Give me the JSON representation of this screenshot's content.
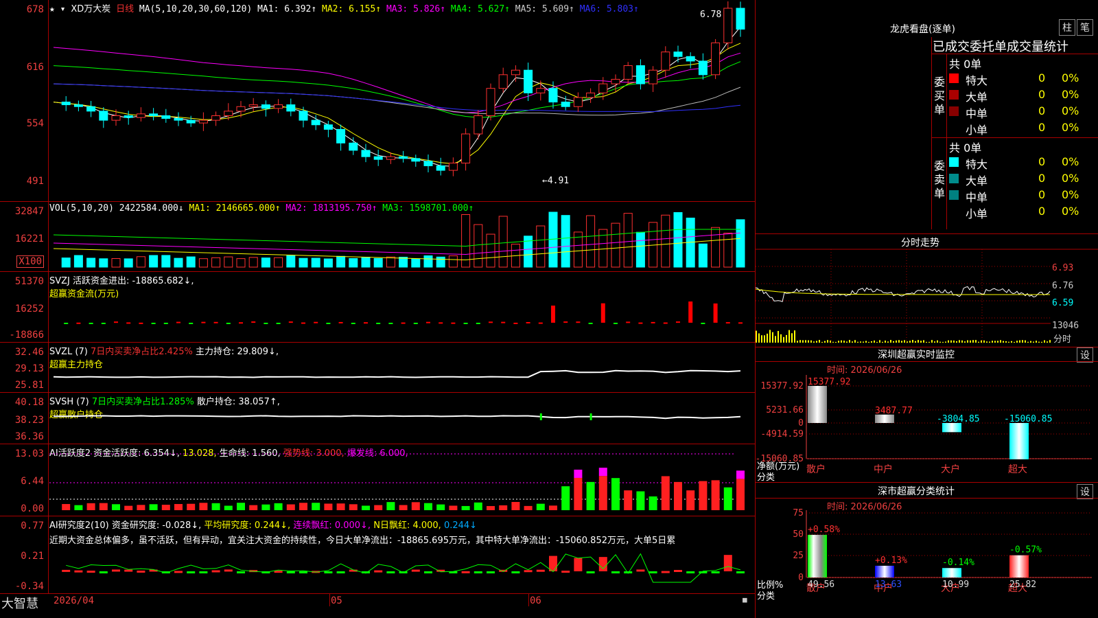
{
  "kline": {
    "stock": "XD万大炭",
    "period": "日线",
    "ma_label": "MA(5,10,20,30,60,120)",
    "ma_values": [
      {
        "text": "MA1: 6.392↑",
        "color": "#ffffff"
      },
      {
        "text": "MA2: 6.155↑",
        "color": "#ffff00"
      },
      {
        "text": "MA3: 5.826↑",
        "color": "#ff00ff"
      },
      {
        "text": "MA4: 5.627↑",
        "color": "#00ff00"
      },
      {
        "text": "MA5: 5.609↑",
        "color": "#cccccc"
      },
      {
        "text": "MA6: 5.803↑",
        "color": "#3030ff"
      }
    ],
    "ticks": [
      "678",
      "616",
      "554",
      "491"
    ],
    "high_label": "6.78",
    "low_label": "←4.91"
  },
  "vol": {
    "title": "VOL(5,10,20)",
    "value": "2422584.000↓",
    "mas": [
      {
        "text": "MA1: 2146665.000↑",
        "color": "#ffff00"
      },
      {
        "text": "MA2: 1813195.750↑",
        "color": "#ff00ff"
      },
      {
        "text": "MA3: 1598701.000↑",
        "color": "#00ff00"
      }
    ],
    "ticks": [
      "32847",
      "16221"
    ],
    "unit": "X100"
  },
  "svzj": {
    "title": "SVZJ  活跃资金进出: -18865.682↓,",
    "subtitle": "超赢资金流(万元)",
    "ticks": [
      "51370",
      "16252",
      "-18866"
    ]
  },
  "svzl": {
    "title_a": "SVZL (7)",
    "title_b": "7日内买卖净占比2.425%",
    "title_c": "主力持仓: 29.809↓,",
    "subtitle": "超赢主力持仓",
    "ticks": [
      "32.46",
      "29.13",
      "25.81"
    ]
  },
  "svsh": {
    "title_a": "SVSH (7)",
    "title_b": "7日内买卖净占比1.285%",
    "title_c": "散户持仓: 38.057↑,",
    "subtitle": "超赢散户持仓",
    "ticks": [
      "40.18",
      "38.23",
      "36.36"
    ]
  },
  "ai1": {
    "title": "AI活跃度2 资金活跃度: 6.354↓,",
    "v2": "13.028,",
    "v3": "生命线: 1.560,",
    "v4": "强势线: 3.000,",
    "v5": "爆发线: 6.000,",
    "ticks": [
      "13.03",
      "6.44",
      "0.00"
    ]
  },
  "ai2": {
    "title": "AI研究度2(10) 资金研究度: -0.028↓,",
    "v2": "平均研究度: 0.244↓,",
    "v3": "连续飘红: 0.000↓,",
    "v4": "N日飘红: 4.000,",
    "v5": "0.244↓",
    "commentary": "近期大资金总体偏多，虽不活跃，但有异动，宜关注大资金的持续性，今日大单净流出：-18865.695万元，其中特大单净流出：-15060.852万元，大单5日累",
    "ticks": [
      "0.77",
      "0.21",
      "-0.34"
    ]
  },
  "bottom": {
    "app": "大智慧",
    "dates": [
      "2026/04",
      "05",
      "06"
    ]
  },
  "lhkp": {
    "title": "龙虎看盘(逐单)",
    "btn1": "柱",
    "btn2": "笔",
    "header": "已成交委托单成交量统计",
    "buy_label": "委买单",
    "sell_label": "委卖单",
    "buy_total": "共 0单",
    "sell_total": "共 0单",
    "rows": [
      {
        "name": "特大",
        "count": "0",
        "pct": "0%"
      },
      {
        "name": "大单",
        "count": "0",
        "pct": "0%"
      },
      {
        "name": "中单",
        "count": "0",
        "pct": "0%"
      },
      {
        "name": "小单",
        "count": "0",
        "pct": "0%"
      }
    ],
    "buy_colors": [
      "#ff0000",
      "#aa0000",
      "#880000",
      ""
    ],
    "sell_colors": [
      "#00ffff",
      "#008b8b",
      "#008080",
      ""
    ]
  },
  "fenshi": {
    "title": "分时走势",
    "ticks": [
      "6.93",
      "6.76",
      "6.59",
      "13046"
    ],
    "label": "分时"
  },
  "szmon": {
    "title": "深圳超赢实时监控",
    "btn": "设",
    "time": "时间: 2026/06/26",
    "ticks": [
      "15377.92",
      "5231.66",
      "0",
      "-4914.59",
      "-15060.85"
    ],
    "ylabel": "净额(万元)",
    "xlabel": "分类",
    "cats": [
      "散户",
      "中户",
      "大户",
      "超大"
    ],
    "values": [
      "15377.92",
      "3487.77",
      "-3804.85",
      "-15060.85"
    ]
  },
  "szcls": {
    "title": "深市超赢分类统计",
    "btn": "设",
    "time": "时间: 2026/06/26",
    "ticks": [
      "75",
      "50",
      "25",
      "0"
    ],
    "ylabel": "比例%",
    "xlabel": "分类",
    "cats": [
      "散户",
      "中户",
      "大户",
      "超大"
    ],
    "pct": [
      "+0.58%",
      "+0.13%",
      "-0.14%",
      "-0.57%"
    ],
    "values": [
      "49.56",
      "13.63",
      "10.99",
      "25.82"
    ]
  }
}
